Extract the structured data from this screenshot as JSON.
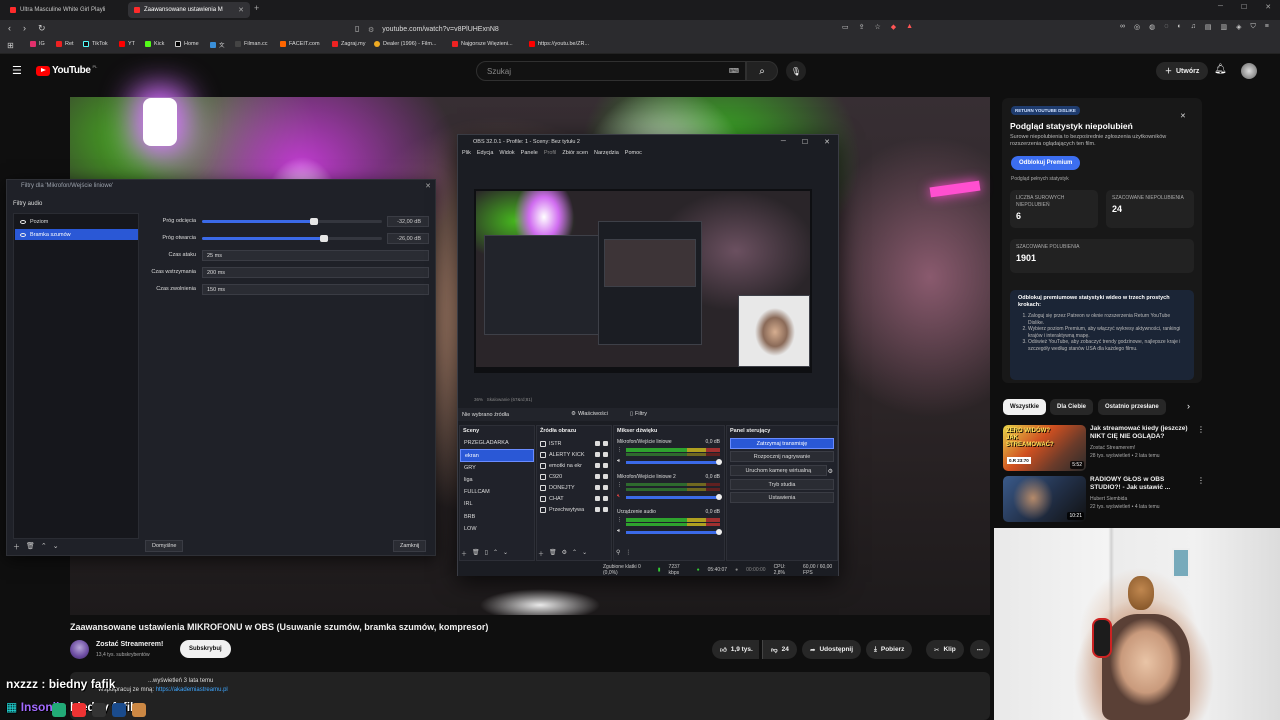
{
  "browser": {
    "tabs": [
      {
        "title": "Ultra Masculine White Girl Playli"
      },
      {
        "title": "Zaawansowane ustawienia M"
      }
    ],
    "url": "youtube.com/watch?v=v8PlUHExnN8",
    "bookmarks": [
      "IG",
      "Ret",
      "TikTok",
      "YT",
      "Kick",
      "Home",
      "文",
      "Filman.cc",
      "FACEIT.com",
      "Zagraj.my",
      "Dealer (1996) - Film...",
      "Najgorsze Więzieni...",
      "https://youtu.be/ZR..."
    ]
  },
  "yt": {
    "logo": "YouTube",
    "region": "PL",
    "search_placeholder": "Szukaj",
    "create_label": "Utwórz",
    "video_title": "Zaawansowane ustawienia MIKROFONU w OBS (Usuwanie szumów, bramka szumów, kompresor)",
    "channel": "Zostać Streamerem!",
    "subs": "13,4 tys. subskrybentów",
    "subscribe": "Subskrybuj",
    "likes": "1,9 tys.",
    "dislikes": "24",
    "share": "Udostępnij",
    "download": "Pobierz",
    "clip": "Klip",
    "desc_line1": "...wyświetleń  3 lata temu",
    "desc_line2_prefix": "Współpracuj ze mną: ",
    "desc_link": "https://akademiastreamu.pl"
  },
  "filter_dialog": {
    "title": "Filtry dla 'Mikrofon/Wejście liniowe'",
    "section": "Filtry audio",
    "filters": [
      "Poziom",
      "Bramka szumów"
    ],
    "rows": [
      {
        "label": "Próg odcięcia",
        "value": "-32,00 dB",
        "level": 0.62
      },
      {
        "label": "Próg otwarcia",
        "value": "-26,00 dB",
        "level": 0.68
      },
      {
        "label": "Czas ataku",
        "value": "25 ms"
      },
      {
        "label": "Czas wstrzymania",
        "value": "200 ms"
      },
      {
        "label": "Czas zwolnienia",
        "value": "150 ms"
      }
    ],
    "defaults": "Domyślne",
    "close": "Zamknij"
  },
  "obs": {
    "title": "OBS 32.0.1 - Profile: 1 - Sceny: Bez tytułu 2",
    "menu": [
      "Plik",
      "Edycja",
      "Widok",
      "Panele",
      "Profil",
      "Zbiór scen",
      "Narzędzia",
      "Pomoc"
    ],
    "no_source": "Nie wybrano źródła",
    "properties": "Właściwości",
    "filters": "Filtry",
    "preview_zoom": "36%",
    "preview_scale": "Skalowanie (67&rd;81)",
    "scenes_title": "Sceny",
    "scenes": [
      "PRZEGLADARKA",
      "ekran",
      "GRY",
      "liga",
      "FULLCAM",
      "IRL",
      "BRB",
      "LOW"
    ],
    "sources_title": "Źródła obrazu",
    "sources": [
      "ISTR",
      "ALERTY KICK",
      "emotki na ekr",
      "C920",
      "DONEJTY",
      "CHAT",
      "Przechwytywa"
    ],
    "mixer_title": "Mikser dźwięku",
    "mixer": [
      {
        "name": "Mikrofon/Wejście liniowe",
        "db": "0,0 dB"
      },
      {
        "name": "Mikrofon/Wejście liniowe 2",
        "db": "0,0 dB"
      },
      {
        "name": "Urządzenie audio",
        "db": "0,0 dB"
      }
    ],
    "control_title": "Panel sterujący",
    "controls": [
      "Zatrzymaj transmisję",
      "Rozpocznij nagrywanie",
      "Uruchom kamerę wirtualną",
      "Tryb studia",
      "Ustawienia"
    ],
    "status": {
      "dropped": "Zgubione klatki 0 (0,0%)",
      "bitrate": "7237 kbps",
      "stream_time": "05:40:07",
      "rec_time": "00:00:00",
      "cpu": "CPU: 2,8%",
      "fps": "60,00 / 60,00 FPS"
    }
  },
  "ryd": {
    "badge": "RETURN YOUTUBE DISLIKE",
    "title": "Podgląd statystyk niepolubień",
    "desc": "Surowe niepolubienia to bezpośrednie zgłoszenia użytkowników rozszerzenia oglądających ten film.",
    "unlock": "Odblokuj Premium",
    "full": "Podgląd pełnych statystyk",
    "raw_label": "LICZBA SUROWYCH NIEPOLUBIEŃ",
    "raw_value": "6",
    "est_label": "SZACOWANE NIEPOLUBIENIA",
    "est_value": "24",
    "likes_label": "SZACOWANE POLUBIENIA",
    "likes_value": "1901",
    "steps_title": "Odblokuj premiumowe statystyki wideo w trzech prostych krokach:",
    "steps": [
      "Zaloguj się przez Patreon w oknie rozszerzenia Return YouTube Dislike.",
      "Wybierz poziom Premium, aby włączyć wykresy aktywności, rankingi krajów i interaktywną mapę.",
      "Odśwież YouTube, aby zobaczyć trendy godzinowe, najlepsze kraje i szczegóły według stanów USA dla każdego filmu."
    ]
  },
  "chips": [
    "Wszystkie",
    "Dla Ciebie",
    "Ostatnio przesłane"
  ],
  "recs": [
    {
      "title": "Jak streamować kiedy (jeszcze) NIKT CIĘ NIE OGLĄDA?",
      "channel": "Zostać Streamerem!",
      "meta": "28 tys. wyświetleń • 2 lata temu",
      "duration": "5:52",
      "thumb_text": "ZERO WIDÓW? JAK STREAMOWAĆ?",
      "thumb_badge": "0.R 23:70"
    },
    {
      "title": "RADIOWY GŁOS w OBS STUDIO?! - Jak ustawić ...",
      "channel": "Hubert Siembida",
      "meta": "22 tys. wyświetleń • 4 lata temu",
      "duration": "10:21"
    }
  ],
  "chat": [
    {
      "user": "nxzzz",
      "msg": "biedny fafik"
    },
    {
      "user": "Insonik",
      "msg": "biedny fafik"
    }
  ],
  "colors": {
    "accent": "#3b6ae8",
    "yt_red": "#ff0000",
    "obs_select": "#2a58d6"
  }
}
